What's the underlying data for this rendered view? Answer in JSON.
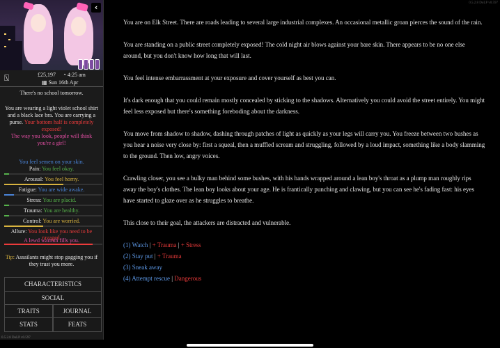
{
  "portrait": {
    "icon_names": [
      "collapse-arrow-icon",
      "stat-vial-icon"
    ]
  },
  "status": {
    "money": "£25,197",
    "time": "4:25 am",
    "date": "Sun 16th Apr"
  },
  "sidebar_text": {
    "school": "There's no school tomorrow.",
    "wearing": "You are wearing a light violet school shirt and a black lace bra. You are carrying a purse.",
    "exposed": "Your bottom half is completely exposed!",
    "look": "The way you look, people will think you're a girl!",
    "semen": "You feel semen on your skin.",
    "tip_label": "Tip:",
    "tip_text": "Assailants might stop gagging you if they trust you more."
  },
  "stats": [
    {
      "label": "Pain:",
      "value": "You feel okay.",
      "color": "#56b24b",
      "fill": 0.05
    },
    {
      "label": "Arousal:",
      "value": "You feel horny.",
      "color": "#d8b33f",
      "fill": 0.6
    },
    {
      "label": "Fatigue:",
      "value": "You are wide awake.",
      "color": "#4a84d8",
      "fill": 0.1
    },
    {
      "label": "Stress:",
      "value": "You are placid.",
      "color": "#56b24b",
      "fill": 0.05
    },
    {
      "label": "Trauma:",
      "value": "You are healthy.",
      "color": "#56b24b",
      "fill": 0.05
    },
    {
      "label": "Control:",
      "value": "You are worried.",
      "color": "#d8b33f",
      "fill": 0.4
    },
    {
      "label": "Allure:",
      "value": "You look like you need to be ravaged.",
      "color": "#ec3b3b",
      "fill": 0.9
    }
  ],
  "lewd_warmth": "A lewd warmth fills you.",
  "buttons": {
    "characteristics": "CHARACTERISTICS",
    "social": "SOCIAL",
    "traits": "TRAITS",
    "journal": "JOURNAL",
    "stats": "STATS",
    "feats": "FEATS"
  },
  "version": "0.5.2.8 DoLP v0.597",
  "passage": [
    "You are on Elk Street. There are roads leading to several large industrial complexes. An occasional metallic groan pierces the sound of the rain.",
    "You are standing on a public street completely exposed! The cold night air blows against your bare skin. There appears to be no one else around, but you don't know how long that will last.",
    "You feel intense embarrassment at your exposure and cover yourself as best you can.",
    "It's dark enough that you could remain mostly concealed by sticking to the shadows. Alternatively you could avoid the street entirely. You might feel less exposed but there's something foreboding about the darkness.",
    "You move from shadow to shadow, dashing through patches of light as quickly as your legs will carry you. You freeze between two bushes as you hear a noise very close by: first a squeal, then a muffled scream and struggling, followed by a loud impact, something like a body slamming to the ground. Then low, angry voices.",
    "Crawling closer, you see a bulky man behind some bushes, with his hands wrapped around a lean boy's throat as a plump man roughly rips away the boy's clothes. The lean boy looks about your age. He is frantically punching and clawing, but you can see he's fading fast: his eyes have started to glaze over as he struggles to breathe.",
    "This close to their goal, the attackers are distracted and vulnerable."
  ],
  "choices": [
    {
      "label": "(1) Watch",
      "tags": [
        "+ Trauma",
        "+ Stress"
      ]
    },
    {
      "label": "(2) Stay put",
      "tags": [
        "+ Trauma"
      ]
    },
    {
      "label": "(3) Sneak away",
      "tags": []
    },
    {
      "label": "(4) Attempt rescue",
      "tags": [
        "Dangerous"
      ]
    }
  ]
}
